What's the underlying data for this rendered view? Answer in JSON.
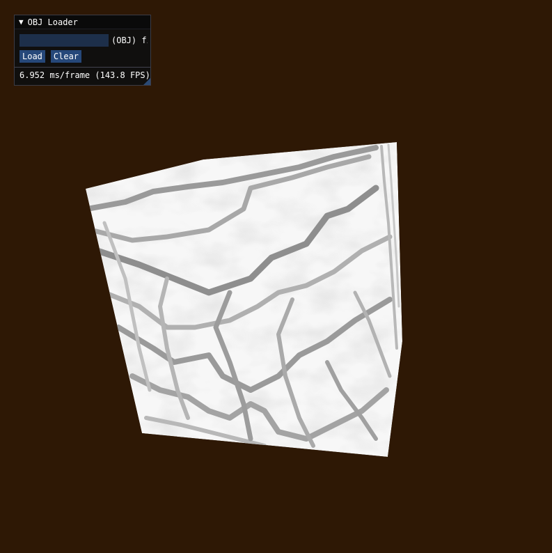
{
  "window": {
    "title": "OBJ Loader",
    "collapse_icon": "triangle-down-icon",
    "input_value": "",
    "input_label": "(OBJ) fi",
    "load_label": "Load",
    "clear_label": "Clear",
    "fps_text": "6.952 ms/frame (143.8 FPS)"
  },
  "colors": {
    "background": "#2e1805",
    "input_bg": "#1d2f4a",
    "button_bg": "#26487a"
  }
}
